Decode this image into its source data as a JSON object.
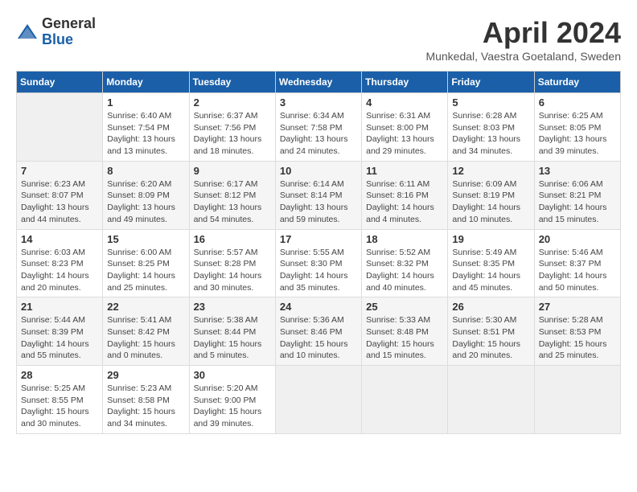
{
  "header": {
    "logo": {
      "general": "General",
      "blue": "Blue"
    },
    "title": "April 2024",
    "location": "Munkedal, Vaestra Goetaland, Sweden"
  },
  "weekdays": [
    "Sunday",
    "Monday",
    "Tuesday",
    "Wednesday",
    "Thursday",
    "Friday",
    "Saturday"
  ],
  "weeks": [
    [
      {
        "day": "",
        "info": ""
      },
      {
        "day": "1",
        "info": "Sunrise: 6:40 AM\nSunset: 7:54 PM\nDaylight: 13 hours\nand 13 minutes."
      },
      {
        "day": "2",
        "info": "Sunrise: 6:37 AM\nSunset: 7:56 PM\nDaylight: 13 hours\nand 18 minutes."
      },
      {
        "day": "3",
        "info": "Sunrise: 6:34 AM\nSunset: 7:58 PM\nDaylight: 13 hours\nand 24 minutes."
      },
      {
        "day": "4",
        "info": "Sunrise: 6:31 AM\nSunset: 8:00 PM\nDaylight: 13 hours\nand 29 minutes."
      },
      {
        "day": "5",
        "info": "Sunrise: 6:28 AM\nSunset: 8:03 PM\nDaylight: 13 hours\nand 34 minutes."
      },
      {
        "day": "6",
        "info": "Sunrise: 6:25 AM\nSunset: 8:05 PM\nDaylight: 13 hours\nand 39 minutes."
      }
    ],
    [
      {
        "day": "7",
        "info": "Sunrise: 6:23 AM\nSunset: 8:07 PM\nDaylight: 13 hours\nand 44 minutes."
      },
      {
        "day": "8",
        "info": "Sunrise: 6:20 AM\nSunset: 8:09 PM\nDaylight: 13 hours\nand 49 minutes."
      },
      {
        "day": "9",
        "info": "Sunrise: 6:17 AM\nSunset: 8:12 PM\nDaylight: 13 hours\nand 54 minutes."
      },
      {
        "day": "10",
        "info": "Sunrise: 6:14 AM\nSunset: 8:14 PM\nDaylight: 13 hours\nand 59 minutes."
      },
      {
        "day": "11",
        "info": "Sunrise: 6:11 AM\nSunset: 8:16 PM\nDaylight: 14 hours\nand 4 minutes."
      },
      {
        "day": "12",
        "info": "Sunrise: 6:09 AM\nSunset: 8:19 PM\nDaylight: 14 hours\nand 10 minutes."
      },
      {
        "day": "13",
        "info": "Sunrise: 6:06 AM\nSunset: 8:21 PM\nDaylight: 14 hours\nand 15 minutes."
      }
    ],
    [
      {
        "day": "14",
        "info": "Sunrise: 6:03 AM\nSunset: 8:23 PM\nDaylight: 14 hours\nand 20 minutes."
      },
      {
        "day": "15",
        "info": "Sunrise: 6:00 AM\nSunset: 8:25 PM\nDaylight: 14 hours\nand 25 minutes."
      },
      {
        "day": "16",
        "info": "Sunrise: 5:57 AM\nSunset: 8:28 PM\nDaylight: 14 hours\nand 30 minutes."
      },
      {
        "day": "17",
        "info": "Sunrise: 5:55 AM\nSunset: 8:30 PM\nDaylight: 14 hours\nand 35 minutes."
      },
      {
        "day": "18",
        "info": "Sunrise: 5:52 AM\nSunset: 8:32 PM\nDaylight: 14 hours\nand 40 minutes."
      },
      {
        "day": "19",
        "info": "Sunrise: 5:49 AM\nSunset: 8:35 PM\nDaylight: 14 hours\nand 45 minutes."
      },
      {
        "day": "20",
        "info": "Sunrise: 5:46 AM\nSunset: 8:37 PM\nDaylight: 14 hours\nand 50 minutes."
      }
    ],
    [
      {
        "day": "21",
        "info": "Sunrise: 5:44 AM\nSunset: 8:39 PM\nDaylight: 14 hours\nand 55 minutes."
      },
      {
        "day": "22",
        "info": "Sunrise: 5:41 AM\nSunset: 8:42 PM\nDaylight: 15 hours\nand 0 minutes."
      },
      {
        "day": "23",
        "info": "Sunrise: 5:38 AM\nSunset: 8:44 PM\nDaylight: 15 hours\nand 5 minutes."
      },
      {
        "day": "24",
        "info": "Sunrise: 5:36 AM\nSunset: 8:46 PM\nDaylight: 15 hours\nand 10 minutes."
      },
      {
        "day": "25",
        "info": "Sunrise: 5:33 AM\nSunset: 8:48 PM\nDaylight: 15 hours\nand 15 minutes."
      },
      {
        "day": "26",
        "info": "Sunrise: 5:30 AM\nSunset: 8:51 PM\nDaylight: 15 hours\nand 20 minutes."
      },
      {
        "day": "27",
        "info": "Sunrise: 5:28 AM\nSunset: 8:53 PM\nDaylight: 15 hours\nand 25 minutes."
      }
    ],
    [
      {
        "day": "28",
        "info": "Sunrise: 5:25 AM\nSunset: 8:55 PM\nDaylight: 15 hours\nand 30 minutes."
      },
      {
        "day": "29",
        "info": "Sunrise: 5:23 AM\nSunset: 8:58 PM\nDaylight: 15 hours\nand 34 minutes."
      },
      {
        "day": "30",
        "info": "Sunrise: 5:20 AM\nSunset: 9:00 PM\nDaylight: 15 hours\nand 39 minutes."
      },
      {
        "day": "",
        "info": ""
      },
      {
        "day": "",
        "info": ""
      },
      {
        "day": "",
        "info": ""
      },
      {
        "day": "",
        "info": ""
      }
    ]
  ]
}
